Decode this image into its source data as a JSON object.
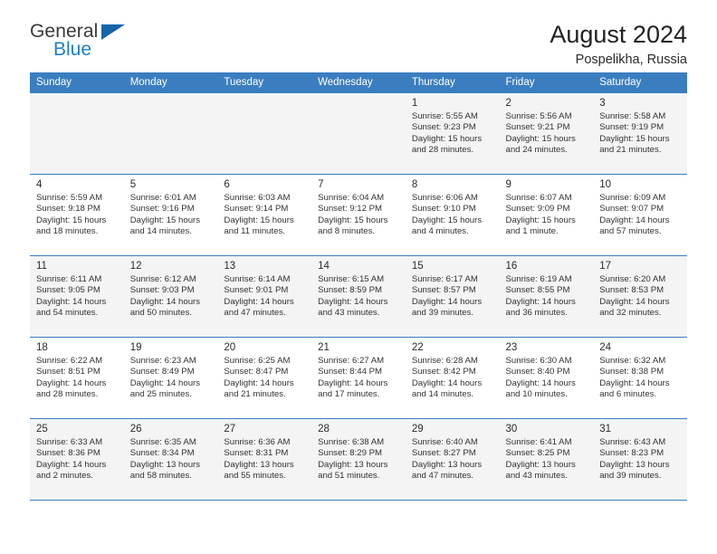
{
  "brand": {
    "name_part1": "General",
    "name_part2": "Blue",
    "triangle_color": "#1565a8",
    "blue": "#1f7fc4"
  },
  "header": {
    "title": "August 2024",
    "location": "Pospelikha, Russia"
  },
  "theme": {
    "header_bg": "#3b7ec0",
    "header_text": "#ffffff",
    "row_shade": "#f4f4f4",
    "grid_line": "#3b7ec0"
  },
  "weekday_headers": [
    "Sunday",
    "Monday",
    "Tuesday",
    "Wednesday",
    "Thursday",
    "Friday",
    "Saturday"
  ],
  "weeks": [
    {
      "shaded": true,
      "days": [
        {
          "num": "",
          "info": ""
        },
        {
          "num": "",
          "info": ""
        },
        {
          "num": "",
          "info": ""
        },
        {
          "num": "",
          "info": ""
        },
        {
          "num": "1",
          "info": "Sunrise: 5:55 AM\nSunset: 9:23 PM\nDaylight: 15 hours\nand 28 minutes."
        },
        {
          "num": "2",
          "info": "Sunrise: 5:56 AM\nSunset: 9:21 PM\nDaylight: 15 hours\nand 24 minutes."
        },
        {
          "num": "3",
          "info": "Sunrise: 5:58 AM\nSunset: 9:19 PM\nDaylight: 15 hours\nand 21 minutes."
        }
      ]
    },
    {
      "shaded": false,
      "days": [
        {
          "num": "4",
          "info": "Sunrise: 5:59 AM\nSunset: 9:18 PM\nDaylight: 15 hours\nand 18 minutes."
        },
        {
          "num": "5",
          "info": "Sunrise: 6:01 AM\nSunset: 9:16 PM\nDaylight: 15 hours\nand 14 minutes."
        },
        {
          "num": "6",
          "info": "Sunrise: 6:03 AM\nSunset: 9:14 PM\nDaylight: 15 hours\nand 11 minutes."
        },
        {
          "num": "7",
          "info": "Sunrise: 6:04 AM\nSunset: 9:12 PM\nDaylight: 15 hours\nand 8 minutes."
        },
        {
          "num": "8",
          "info": "Sunrise: 6:06 AM\nSunset: 9:10 PM\nDaylight: 15 hours\nand 4 minutes."
        },
        {
          "num": "9",
          "info": "Sunrise: 6:07 AM\nSunset: 9:09 PM\nDaylight: 15 hours\nand 1 minute."
        },
        {
          "num": "10",
          "info": "Sunrise: 6:09 AM\nSunset: 9:07 PM\nDaylight: 14 hours\nand 57 minutes."
        }
      ]
    },
    {
      "shaded": true,
      "days": [
        {
          "num": "11",
          "info": "Sunrise: 6:11 AM\nSunset: 9:05 PM\nDaylight: 14 hours\nand 54 minutes."
        },
        {
          "num": "12",
          "info": "Sunrise: 6:12 AM\nSunset: 9:03 PM\nDaylight: 14 hours\nand 50 minutes."
        },
        {
          "num": "13",
          "info": "Sunrise: 6:14 AM\nSunset: 9:01 PM\nDaylight: 14 hours\nand 47 minutes."
        },
        {
          "num": "14",
          "info": "Sunrise: 6:15 AM\nSunset: 8:59 PM\nDaylight: 14 hours\nand 43 minutes."
        },
        {
          "num": "15",
          "info": "Sunrise: 6:17 AM\nSunset: 8:57 PM\nDaylight: 14 hours\nand 39 minutes."
        },
        {
          "num": "16",
          "info": "Sunrise: 6:19 AM\nSunset: 8:55 PM\nDaylight: 14 hours\nand 36 minutes."
        },
        {
          "num": "17",
          "info": "Sunrise: 6:20 AM\nSunset: 8:53 PM\nDaylight: 14 hours\nand 32 minutes."
        }
      ]
    },
    {
      "shaded": false,
      "days": [
        {
          "num": "18",
          "info": "Sunrise: 6:22 AM\nSunset: 8:51 PM\nDaylight: 14 hours\nand 28 minutes."
        },
        {
          "num": "19",
          "info": "Sunrise: 6:23 AM\nSunset: 8:49 PM\nDaylight: 14 hours\nand 25 minutes."
        },
        {
          "num": "20",
          "info": "Sunrise: 6:25 AM\nSunset: 8:47 PM\nDaylight: 14 hours\nand 21 minutes."
        },
        {
          "num": "21",
          "info": "Sunrise: 6:27 AM\nSunset: 8:44 PM\nDaylight: 14 hours\nand 17 minutes."
        },
        {
          "num": "22",
          "info": "Sunrise: 6:28 AM\nSunset: 8:42 PM\nDaylight: 14 hours\nand 14 minutes."
        },
        {
          "num": "23",
          "info": "Sunrise: 6:30 AM\nSunset: 8:40 PM\nDaylight: 14 hours\nand 10 minutes."
        },
        {
          "num": "24",
          "info": "Sunrise: 6:32 AM\nSunset: 8:38 PM\nDaylight: 14 hours\nand 6 minutes."
        }
      ]
    },
    {
      "shaded": true,
      "days": [
        {
          "num": "25",
          "info": "Sunrise: 6:33 AM\nSunset: 8:36 PM\nDaylight: 14 hours\nand 2 minutes."
        },
        {
          "num": "26",
          "info": "Sunrise: 6:35 AM\nSunset: 8:34 PM\nDaylight: 13 hours\nand 58 minutes."
        },
        {
          "num": "27",
          "info": "Sunrise: 6:36 AM\nSunset: 8:31 PM\nDaylight: 13 hours\nand 55 minutes."
        },
        {
          "num": "28",
          "info": "Sunrise: 6:38 AM\nSunset: 8:29 PM\nDaylight: 13 hours\nand 51 minutes."
        },
        {
          "num": "29",
          "info": "Sunrise: 6:40 AM\nSunset: 8:27 PM\nDaylight: 13 hours\nand 47 minutes."
        },
        {
          "num": "30",
          "info": "Sunrise: 6:41 AM\nSunset: 8:25 PM\nDaylight: 13 hours\nand 43 minutes."
        },
        {
          "num": "31",
          "info": "Sunrise: 6:43 AM\nSunset: 8:23 PM\nDaylight: 13 hours\nand 39 minutes."
        }
      ]
    }
  ]
}
